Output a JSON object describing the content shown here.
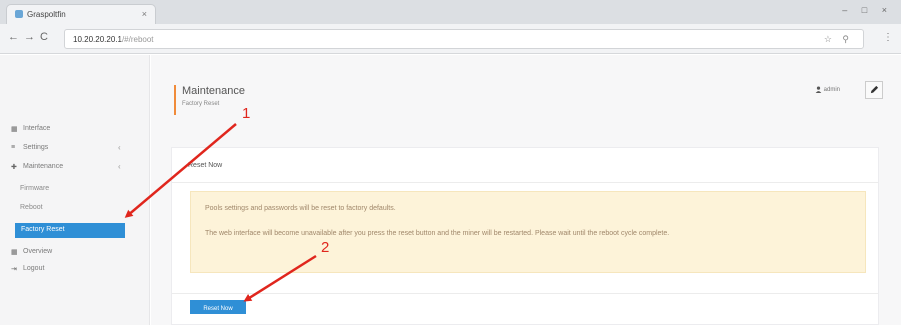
{
  "browser": {
    "tab_title": "Graspoltfin",
    "tab_close": "×",
    "window_controls": "– □ ×",
    "url_host": "10.20.20.20.1",
    "url_path": "/#/reboot",
    "nav": {
      "back": "←",
      "forward": "→",
      "reload": "C"
    },
    "omni_icons": "☆ ⚲",
    "menu": "⋮"
  },
  "sidebar": {
    "items": [
      {
        "icon": "▦",
        "label": "Interface",
        "caret": ""
      },
      {
        "icon": "≡",
        "label": "Settings",
        "caret": "‹"
      },
      {
        "icon": "✚",
        "label": "Maintenance",
        "caret": "‹"
      }
    ],
    "subitems": [
      {
        "label": "Firmware"
      },
      {
        "label": "Reboot"
      }
    ],
    "active": {
      "label": "Factory Reset"
    },
    "bottom_items": [
      {
        "icon": "▦",
        "label": "Overview"
      },
      {
        "icon": "⇥",
        "label": "Logout"
      }
    ]
  },
  "header": {
    "title": "Maintenance",
    "subtitle": "Factory Reset",
    "user": "admin",
    "user_icon": "person-icon",
    "edit_icon": "pencil-icon"
  },
  "panel": {
    "title": "Reset Now",
    "warning_line1": "Pools settings and passwords will be reset to factory defaults.",
    "warning_line2": "The web interface will become unavailable after you press the reset button and the miner will be restarted. Please wait until the reboot cycle complete.",
    "button_label": "Reset Now"
  },
  "annotations": {
    "step1": "1",
    "step2": "2",
    "color": "#e0261d"
  },
  "colors": {
    "accent": "#2f8fd6",
    "title_bar": "#f08b3a",
    "warning_bg": "#fdf3d9"
  }
}
